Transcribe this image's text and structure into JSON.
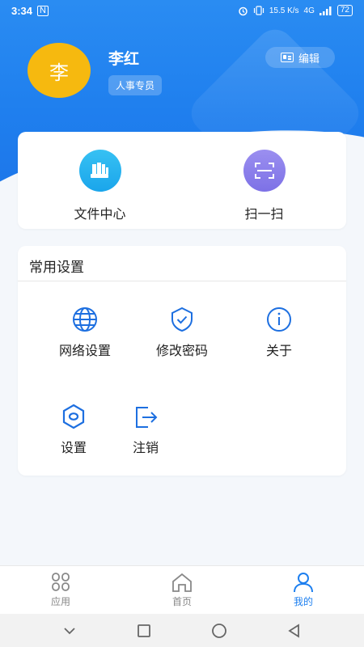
{
  "status": {
    "time": "3:34",
    "nfc": "N",
    "speed": "15.5 K/s",
    "network": "4G",
    "battery": "72"
  },
  "profile": {
    "avatar_char": "李",
    "name": "李红",
    "role": "人事专员",
    "edit_label": "编辑"
  },
  "quick_actions": [
    {
      "label": "文件中心",
      "icon": "folder-icon"
    },
    {
      "label": "扫一扫",
      "icon": "scan-icon"
    }
  ],
  "settings": {
    "title": "常用设置",
    "items": [
      {
        "label": "网络设置",
        "icon": "globe-icon"
      },
      {
        "label": "修改密码",
        "icon": "shield-check-icon"
      },
      {
        "label": "关于",
        "icon": "info-icon"
      },
      {
        "label": "设置",
        "icon": "hexagon-icon"
      },
      {
        "label": "注销",
        "icon": "logout-icon"
      }
    ]
  },
  "tabbar": [
    {
      "label": "应用",
      "icon": "apps-icon",
      "active": false
    },
    {
      "label": "首页",
      "icon": "home-icon",
      "active": false
    },
    {
      "label": "我的",
      "icon": "user-icon",
      "active": true
    }
  ],
  "colors": {
    "primary": "#1d7fef",
    "avatar": "#f6b90f"
  }
}
